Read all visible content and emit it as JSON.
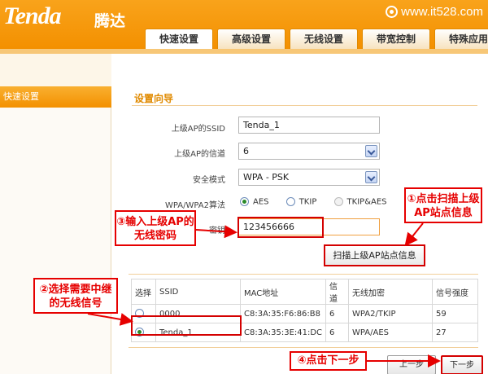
{
  "header": {
    "logo": "Tenda",
    "logo_cn": "腾达",
    "watermark": "www.it528.com"
  },
  "tabs": [
    {
      "label": "快速设置",
      "active": true
    },
    {
      "label": "高级设置",
      "active": false
    },
    {
      "label": "无线设置",
      "active": false
    },
    {
      "label": "带宽控制",
      "active": false
    },
    {
      "label": "特殊应用",
      "active": false
    }
  ],
  "sidebar": {
    "items": [
      {
        "label": "快速设置"
      }
    ]
  },
  "wizard": {
    "title": "设置向导",
    "ssid_label": "上级AP的SSID",
    "ssid_value": "Tenda_1",
    "channel_label": "上级AP的信道",
    "channel_value": "6",
    "security_label": "安全模式",
    "security_value": "WPA - PSK",
    "cipher_label": "WPA/WPA2算法",
    "cipher_options": [
      "AES",
      "TKIP",
      "TKIP&AES"
    ],
    "password_label": "密钥",
    "password_value": "123456666",
    "scan_button": "扫描上级AP站点信息"
  },
  "table": {
    "headers": [
      "选择",
      "SSID",
      "MAC地址",
      "信道",
      "无线加密",
      "信号强度"
    ],
    "rows": [
      {
        "ssid": "0000",
        "mac": "C8:3A:35:F6:86:B8",
        "channel": "6",
        "enc": "WPA2/TKIP",
        "signal": "59"
      },
      {
        "ssid": "Tenda_1",
        "mac": "C8:3A:35:3E:41:DC",
        "channel": "6",
        "enc": "WPA/AES",
        "signal": "27"
      }
    ]
  },
  "buttons": {
    "prev": "上一步",
    "next": "下一步"
  },
  "annotations": {
    "scan": "①点击扫描上级AP站点信息",
    "password": "③输入上级AP的无线密码",
    "select": "②选择需要中继的无线信号",
    "next": "④点击下一步"
  },
  "colors": {
    "brand_orange": "#f39000",
    "annotation_red": "#e60000"
  }
}
